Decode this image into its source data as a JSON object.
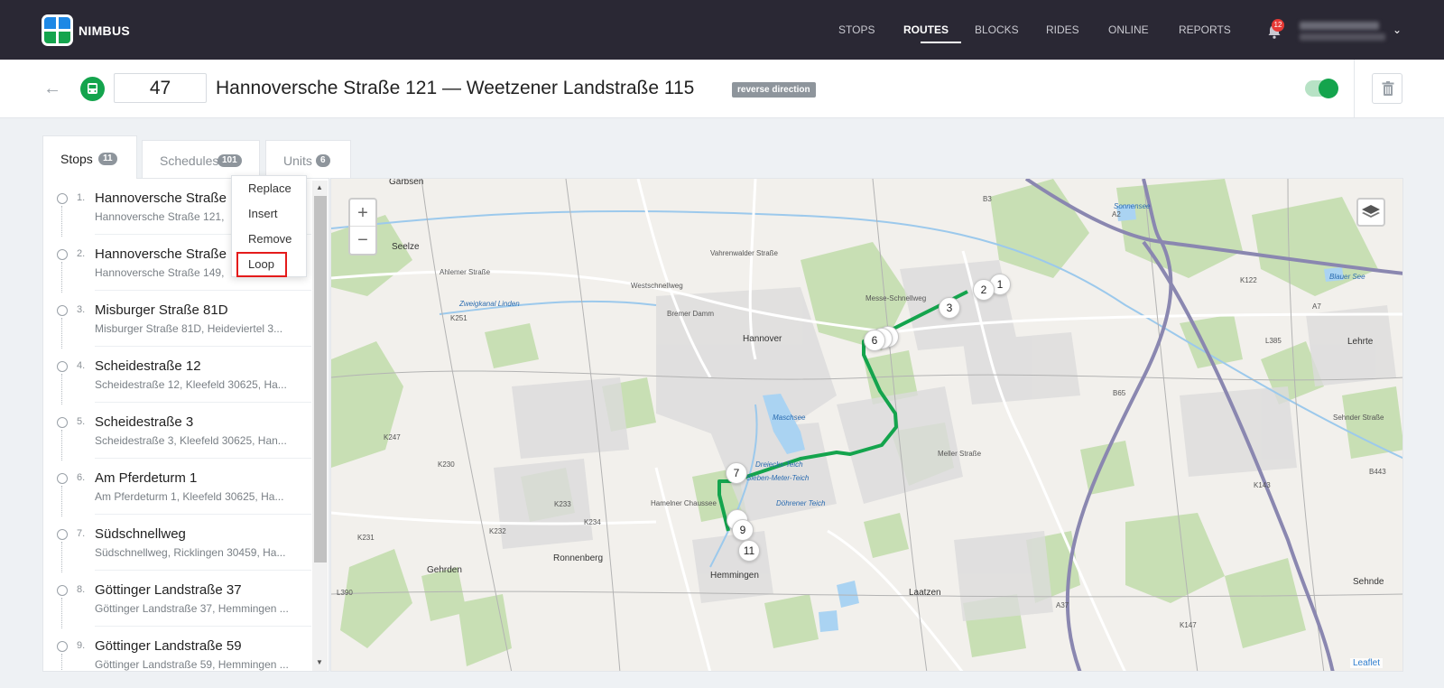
{
  "app": {
    "brand": "NIMBUS"
  },
  "nav": {
    "items": [
      {
        "label": "STOPS",
        "active": false
      },
      {
        "label": "ROUTES",
        "active": true
      },
      {
        "label": "BLOCKS",
        "active": false
      },
      {
        "label": "RIDES",
        "active": false
      },
      {
        "label": "ONLINE",
        "active": false
      },
      {
        "label": "REPORTS",
        "active": false
      }
    ],
    "notifications": "12"
  },
  "header": {
    "route_number": "47",
    "route_title": "Hannoversche Straße 121 — Weetzener Landstraße 115",
    "direction_badge": "reverse direction",
    "active_toggle": true
  },
  "tabs": [
    {
      "label": "Stops",
      "count": "11",
      "active": true
    },
    {
      "label": "Schedules",
      "count": "101",
      "active": false
    },
    {
      "label": "Units",
      "count": "6",
      "active": false
    }
  ],
  "stops": [
    {
      "num": "1.",
      "name": "Hannoversche Straße 1",
      "address": "Hannoversche Straße 121,"
    },
    {
      "num": "2.",
      "name": "Hannoversche Straße 1",
      "address": "Hannoversche Straße 149,"
    },
    {
      "num": "3.",
      "name": "Misburger Straße 81D",
      "address": "Misburger Straße 81D, Heideviertel 3..."
    },
    {
      "num": "4.",
      "name": "Scheidestraße 12",
      "address": "Scheidestraße 12, Kleefeld 30625, Ha..."
    },
    {
      "num": "5.",
      "name": "Scheidestraße 3",
      "address": "Scheidestraße 3, Kleefeld 30625, Han..."
    },
    {
      "num": "6.",
      "name": "Am Pferdeturm 1",
      "address": "Am Pferdeturm 1, Kleefeld 30625, Ha..."
    },
    {
      "num": "7.",
      "name": "Südschnellweg",
      "address": "Südschnellweg, Ricklingen 30459, Ha..."
    },
    {
      "num": "8.",
      "name": "Göttinger Landstraße 37",
      "address": "Göttinger Landstraße 37, Hemmingen ..."
    },
    {
      "num": "9.",
      "name": "Göttinger Landstraße 59",
      "address": "Göttinger Landstraße 59, Hemmingen ..."
    }
  ],
  "context_menu": {
    "items": [
      "Replace",
      "Insert",
      "Remove",
      "Loop"
    ],
    "highlighted": "Loop"
  },
  "map": {
    "zoom_in": "+",
    "zoom_out": "−",
    "attribution": "Leaflet",
    "place_labels": [
      "Garbsen",
      "Seelze",
      "Hannover",
      "Ronnenberg",
      "Gehrden",
      "Hemmingen",
      "Laatzen",
      "Lehrte",
      "Sehnde"
    ],
    "water_labels": [
      "Zweigkanal Linden",
      "Maschsee",
      "Dreiecks-Teich",
      "Sieben-Meter-Teich",
      "Döhrener Teich",
      "Sonnensee",
      "Blauer See"
    ],
    "road_labels": [
      "Ahlemer Straße",
      "Bremer Damm",
      "Westschnellweg",
      "Vahrenwalder Straße",
      "Messe-Schnellweg",
      "Hamelner Chaussee",
      "A2",
      "A7",
      "B3",
      "B65",
      "B443",
      "K251",
      "K247",
      "K230",
      "K232",
      "K233",
      "K234",
      "K231",
      "L385",
      "L390",
      "A37",
      "K122",
      "K143",
      "K147",
      "Sehnder Straße",
      "Meller Straße"
    ],
    "markers": [
      "1",
      "2",
      "3",
      "6",
      "7",
      "9",
      "11"
    ]
  },
  "colors": {
    "accent": "#14a44d",
    "route": "#14a44d",
    "nav_bg": "#2a2834",
    "highlight": "#e41b1b"
  }
}
